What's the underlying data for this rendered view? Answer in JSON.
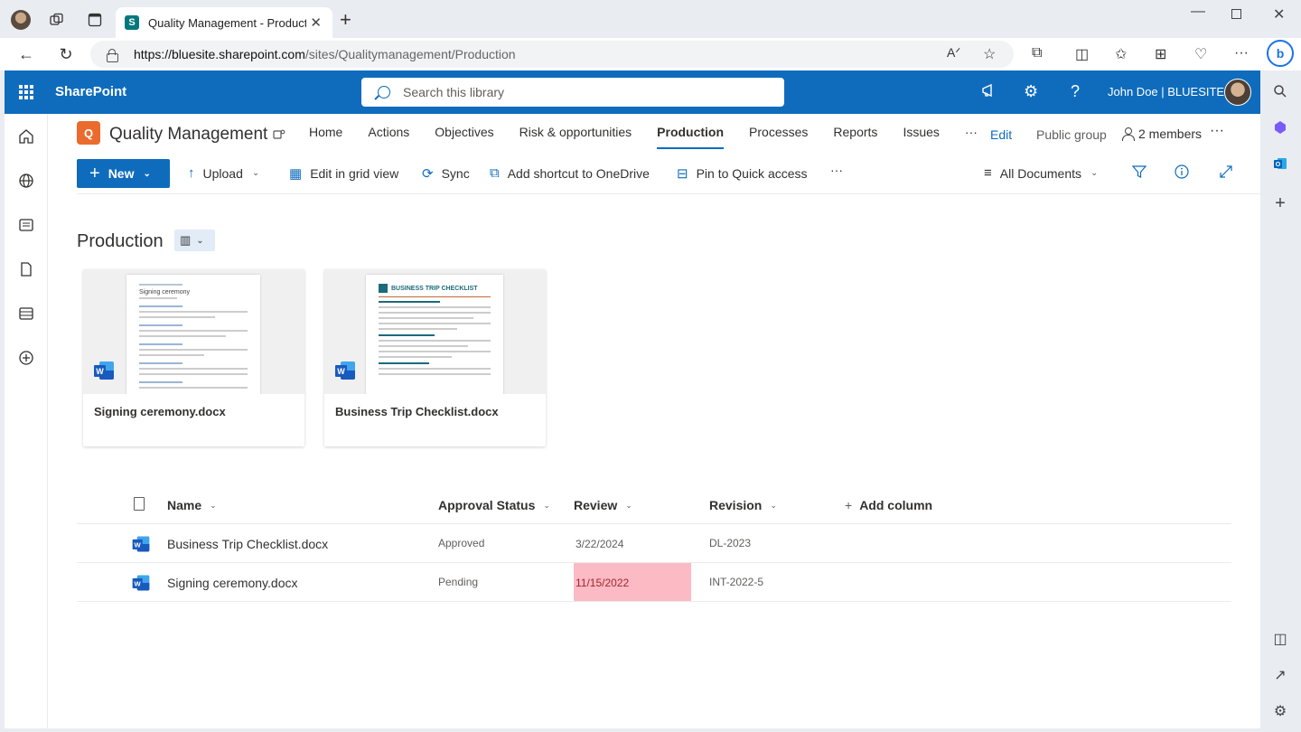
{
  "browser": {
    "tab_title": "Quality Management - Productio",
    "url_host": "https://bluesite.sharepoint.com",
    "url_path": "/sites/Qualitymanagement/Production"
  },
  "suite": {
    "brand": "SharePoint",
    "search_placeholder": "Search this library",
    "user": "John Doe | BLUESITE"
  },
  "site": {
    "logo_letter": "Q",
    "title": "Quality Management",
    "nav": [
      "Home",
      "Actions",
      "Objectives",
      "Risk & opportunities",
      "Production",
      "Processes",
      "Reports",
      "Issues"
    ],
    "active_nav": "Production",
    "more": "···",
    "edit": "Edit",
    "group": "Public group",
    "members": "2 members"
  },
  "commands": {
    "new": "New",
    "upload": "Upload",
    "grid": "Edit in grid view",
    "sync": "Sync",
    "shortcut": "Add shortcut to OneDrive",
    "pin": "Pin to Quick access",
    "more": "···",
    "view": "All Documents"
  },
  "library": {
    "title": "Production",
    "tiles": [
      {
        "name": "Signing ceremony.docx",
        "preview_title": "Signing ceremony"
      },
      {
        "name": "Business Trip Checklist.docx",
        "preview_title": "BUSINESS TRIP CHECKLIST"
      }
    ],
    "columns": {
      "name": "Name",
      "approval": "Approval Status",
      "review": "Review",
      "revision": "Revision",
      "add": "Add column"
    },
    "rows": [
      {
        "name": "Business Trip Checklist.docx",
        "approval": "Approved",
        "review": "3/22/2024",
        "revision": "DL-2023",
        "overdue": false
      },
      {
        "name": "Signing ceremony.docx",
        "approval": "Pending",
        "review": "11/15/2022",
        "revision": "INT-2022-5",
        "overdue": true
      }
    ]
  },
  "colors": {
    "suite": "#0f6cbd",
    "overdue_bg": "#fbbac4",
    "logo": "#ea6b2d"
  }
}
